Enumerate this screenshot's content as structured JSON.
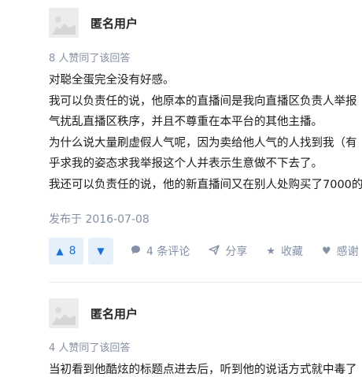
{
  "answers": [
    {
      "author": "匿名用户",
      "votes_text": "8 人赞同了该回答",
      "paragraphs": [
        "对聪全蛋完全没有好感。",
        "我可以负责任的说，他原本的直播间是我向直播区负责人举报",
        "气扰乱直播区秩序，并且不尊重在本平台的其他主播。",
        "为什么说大量刷虚假人气呢，因为卖给他人气的人找到我（有",
        "乎求我的姿态求我举报这个人并表示生意做不下去了。",
        "我还可以负责任的说，他的新直播间又在别人处购买了7000的"
      ],
      "date": "发布于 2016-07-08",
      "upvotes": "8",
      "comments": "4 条评论",
      "share": "分享",
      "collect": "收藏",
      "thanks": "感谢"
    },
    {
      "author": "匿名用户",
      "votes_text": "4 人赞同了该回答",
      "paragraphs": [
        "当初看到他酷炫的标题点进去后，听到他的说话方式就中毒了"
      ]
    }
  ],
  "icons": {
    "vote_up": "triangle-up-icon",
    "vote_down": "triangle-down-icon",
    "comment": "comment-bubble-icon",
    "share": "paper-plane-icon",
    "collect": "star-icon",
    "thanks": "heart-icon"
  },
  "colors": {
    "accent": "#1e6fd9",
    "accent_bg": "#e6f0fb",
    "meta": "#8590a6"
  }
}
